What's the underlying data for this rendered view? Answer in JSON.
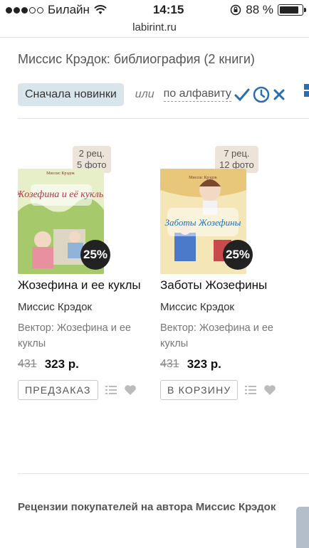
{
  "status": {
    "carrier": "Билайн",
    "time": "14:15",
    "battery": "88 %",
    "battery_level": 0.88
  },
  "url": "labirint.ru",
  "page": {
    "title": "Миссис Крэдок: библиография (2 книги)"
  },
  "sort": {
    "active": "Сначала новинки",
    "or": "или",
    "alternative": "по алфавиту"
  },
  "products": [
    {
      "reviews": "2 рец.",
      "photos": "5 фото",
      "cover_title": "Жозефина и её куклы",
      "cover_author": "Миссис Крэдок",
      "discount": "25%",
      "title": "Жозефина и ее куклы",
      "author": "Миссис Крэдок",
      "series": "Вектор: Жозефина и ее куклы",
      "old_price": "431",
      "price": "323 р.",
      "action": "ПРЕДЗАКАЗ"
    },
    {
      "reviews": "7 рец.",
      "photos": "12 фото",
      "cover_title": "Заботы Жозефины",
      "cover_author": "Миссис Крэдок",
      "discount": "25%",
      "title": "Заботы Жозефины",
      "author": "Миссис Крэдок",
      "series": "Вектор: Жозефина и ее куклы",
      "old_price": "431",
      "price": "323 р.",
      "action": "В КОРЗИНУ"
    }
  ],
  "reviews_heading": "Рецензии покупателей на автора Миссис Крэдок",
  "colors": {
    "accent": "#2a6db0",
    "sort_active_bg": "#d8e6ec",
    "badge_bg": "#ece4d8"
  }
}
